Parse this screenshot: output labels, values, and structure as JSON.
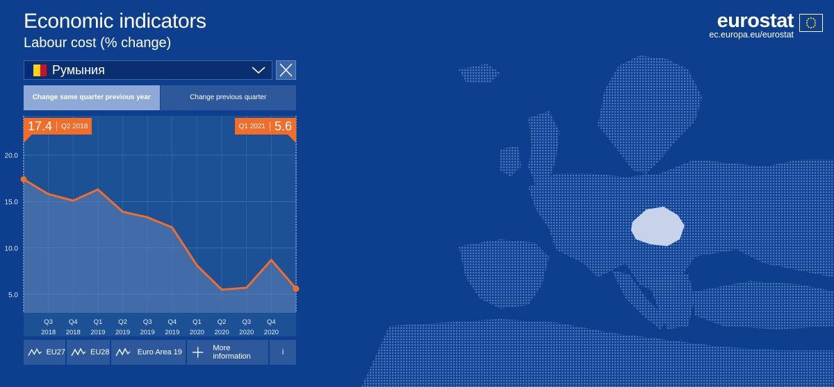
{
  "header": {
    "title": "Economic indicators",
    "subtitle": "Labour cost (% change)"
  },
  "logo": {
    "brand": "eurostat",
    "url": "ec.europa.eu/eurostat"
  },
  "selector": {
    "country": "Румыния",
    "flag_colors": [
      "#002b7f",
      "#fcd116",
      "#ce1126"
    ]
  },
  "tabs": [
    {
      "label": "Change same quarter previous year",
      "active": true
    },
    {
      "label": "Change previous quarter",
      "active": false
    }
  ],
  "callouts": {
    "start_value": "17.4",
    "start_period": "Q2 2018",
    "end_period": "Q1 2021",
    "end_value": "5.6"
  },
  "bottom_bar": {
    "eu27": "EU27",
    "eu28": "EU28",
    "euro_area": "Euro Area 19",
    "more": "More information",
    "info": "i"
  },
  "colors": {
    "accent": "#f26d2a",
    "background": "#0e3f8f"
  },
  "chart_data": {
    "type": "area",
    "title": "",
    "xlabel": "",
    "ylabel": "",
    "ylim": [
      3.0,
      22.0
    ],
    "yticks": [
      5.0,
      10.0,
      15.0,
      20.0
    ],
    "ytick_labels": [
      "5.0",
      "10.0",
      "15.0",
      "20.0"
    ],
    "x_labels": [
      {
        "q": "Q3",
        "y": "2018"
      },
      {
        "q": "Q4",
        "y": "2018"
      },
      {
        "q": "Q1",
        "y": "2019"
      },
      {
        "q": "Q2",
        "y": "2019"
      },
      {
        "q": "Q3",
        "y": "2019"
      },
      {
        "q": "Q4",
        "y": "2019"
      },
      {
        "q": "Q1",
        "y": "2020"
      },
      {
        "q": "Q2",
        "y": "2020"
      },
      {
        "q": "Q3",
        "y": "2020"
      },
      {
        "q": "Q4",
        "y": "2020"
      }
    ],
    "x": [
      "Q2 2018",
      "Q3 2018",
      "Q4 2018",
      "Q1 2019",
      "Q2 2019",
      "Q3 2019",
      "Q4 2019",
      "Q1 2020",
      "Q2 2020",
      "Q3 2020",
      "Q4 2020",
      "Q1 2021"
    ],
    "values": [
      17.4,
      15.8,
      15.1,
      16.3,
      13.9,
      13.3,
      12.2,
      8.1,
      5.5,
      5.7,
      8.7,
      5.6
    ],
    "grid": true
  }
}
